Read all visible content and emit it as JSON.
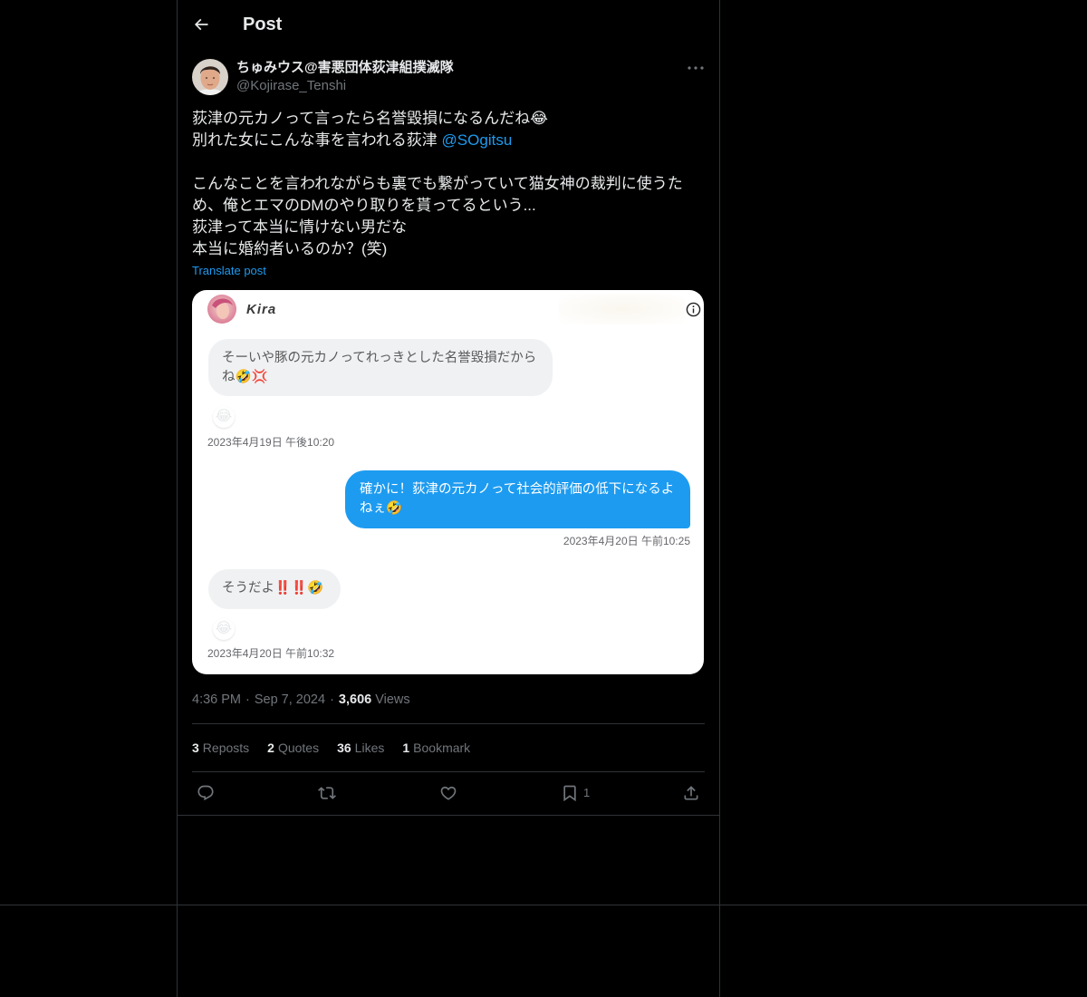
{
  "header": {
    "title": "Post"
  },
  "post": {
    "author": {
      "name": "ちゅみウス@害悪団体荻津組撲滅隊",
      "handle": "@Kojirase_Tenshi"
    },
    "body": {
      "paragraph_1": [
        "荻津の元カノって言ったら名誉毀損になるんだね😂",
        "別れた女にこんな事を言われる荻津 "
      ],
      "mention": "@SOgitsu",
      "paragraph_2": [
        "こんなことを言われながらも裏でも繋がっていて猫女神の裁判に使うた",
        "め、俺とエマのDMのやり取りを貰ってるという...",
        "荻津って本当に情けない男だな",
        "本当に婚約者いるのか？(笑)"
      ]
    },
    "translate_label": "Translate post",
    "embedded_image": {
      "contact_name": "Kira",
      "messages": [
        {
          "lines": [
            "そーいや豚の元カノってれっきとした名誉毀損だから",
            "ね🤣💢"
          ],
          "reaction": "😂",
          "timestamp": "2023年4月19日 午後10:20"
        },
        {
          "lines": [
            "確かに！荻津の元カノって社会的評価の低下になるよ",
            "ねぇ🤣"
          ],
          "timestamp": "2023年4月20日 午前10:25"
        },
        {
          "lines": [
            "そうだよ‼️‼️🤣"
          ],
          "reaction": "😂",
          "timestamp": "2023年4月20日 午前10:32"
        }
      ]
    },
    "meta": {
      "time": "4:36 PM",
      "separator": "·",
      "date": "Sep 7, 2024",
      "views_count": "3,606",
      "views_label": "Views"
    },
    "stats": [
      {
        "count": "3",
        "label": "Reposts"
      },
      {
        "count": "2",
        "label": "Quotes"
      },
      {
        "count": "36",
        "label": "Likes"
      },
      {
        "count": "1",
        "label": "Bookmark"
      }
    ],
    "actions": {
      "bookmark_count": "1"
    }
  },
  "icons": {
    "back": "arrow-left-icon",
    "more": "more-dots-icon",
    "info": "info-icon",
    "reply": "reply-icon",
    "repost": "repost-icon",
    "like": "heart-icon",
    "bookmark": "bookmark-icon",
    "share": "share-icon"
  },
  "colors": {
    "background": "#000000",
    "text": "#e7e9ea",
    "muted": "#71767b",
    "border": "#2f3336",
    "link": "#1d9bf0",
    "dm_outgoing_bubble": "#1d9bf0",
    "dm_incoming_bubble": "#eff1f3",
    "image_background": "#ffffff"
  }
}
